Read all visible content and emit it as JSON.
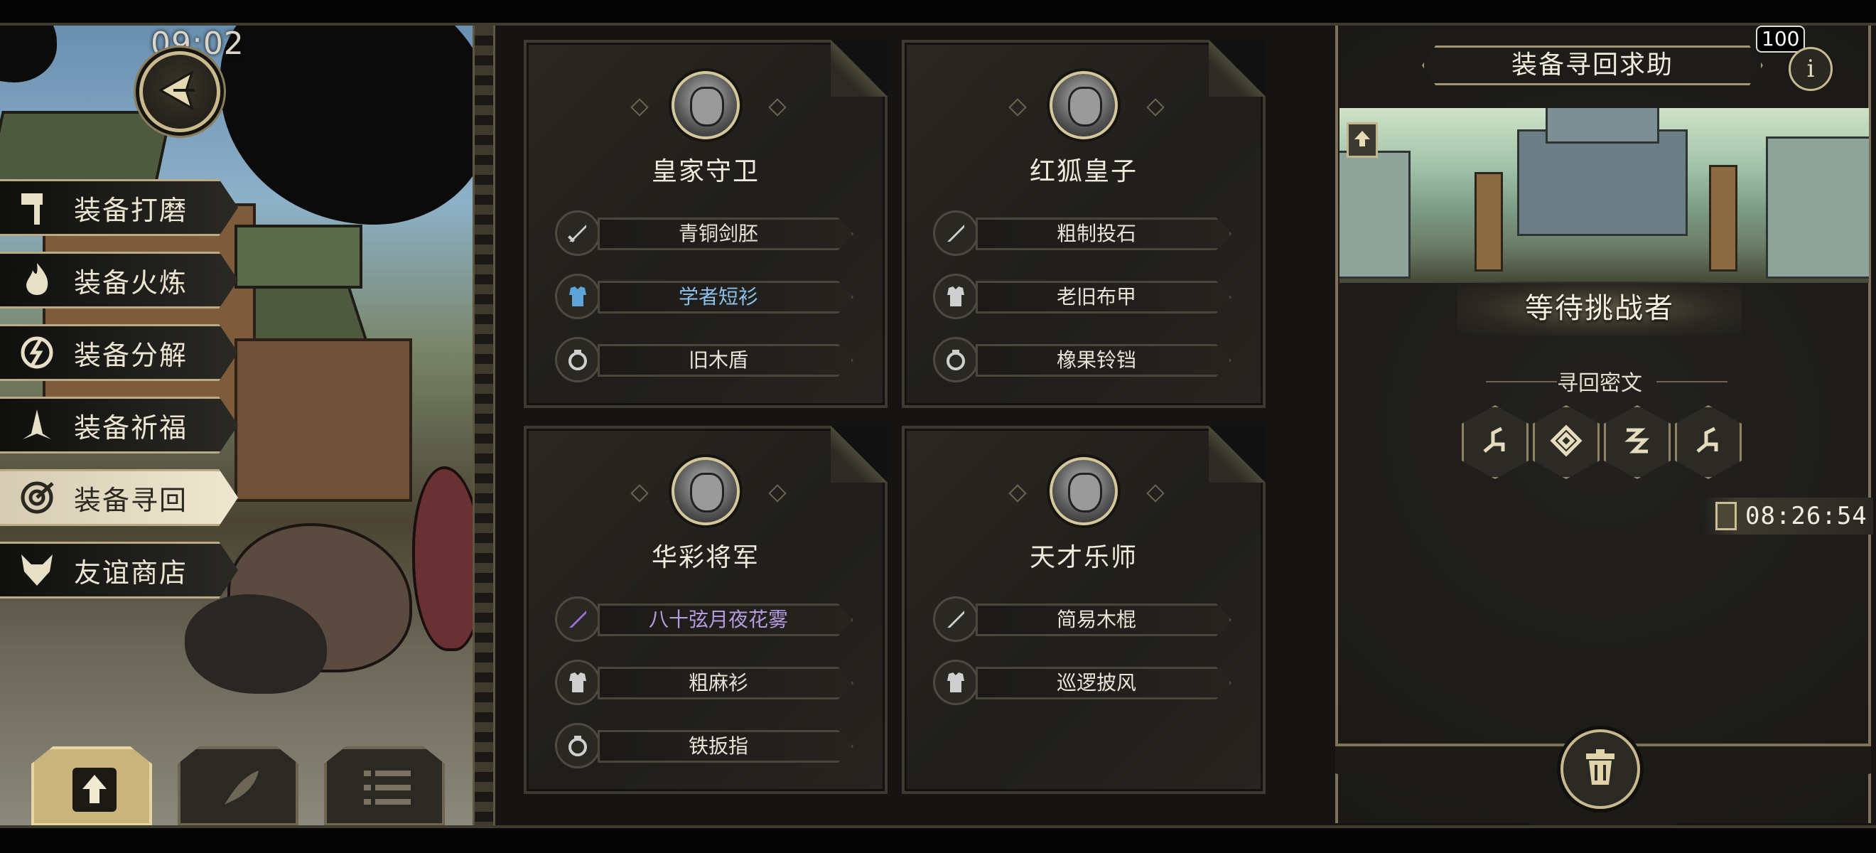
{
  "status": {
    "time": "09:02",
    "energy": "100"
  },
  "side_menu": {
    "items": [
      {
        "label": "装备打磨",
        "icon": "hammer-icon"
      },
      {
        "label": "装备火炼",
        "icon": "flame-icon"
      },
      {
        "label": "装备分解",
        "icon": "disassemble-icon"
      },
      {
        "label": "装备祈福",
        "icon": "prayer-icon"
      },
      {
        "label": "装备寻回",
        "icon": "target-icon",
        "active": true
      },
      {
        "label": "友谊商店",
        "icon": "fox-icon"
      }
    ]
  },
  "bottom_buttons": [
    {
      "icon": "upload-icon"
    },
    {
      "icon": "quill-icon"
    },
    {
      "icon": "list-icon"
    }
  ],
  "cards": [
    {
      "name": "皇家守卫",
      "portrait": "armored-knight-portrait",
      "items": [
        {
          "label": "青铜剑胚",
          "slot": "weapon",
          "rarity": "common"
        },
        {
          "label": "学者短衫",
          "slot": "armor",
          "rarity": "rare"
        },
        {
          "label": "旧木盾",
          "slot": "accessory",
          "rarity": "common"
        }
      ]
    },
    {
      "name": "红狐皇子",
      "portrait": "wolf-prince-portrait",
      "items": [
        {
          "label": "粗制投石",
          "slot": "weapon",
          "rarity": "common"
        },
        {
          "label": "老旧布甲",
          "slot": "armor",
          "rarity": "common"
        },
        {
          "label": "橡果铃铛",
          "slot": "accessory",
          "rarity": "common"
        }
      ]
    },
    {
      "name": "华彩将军",
      "portrait": "helmeted-general-portrait",
      "items": [
        {
          "label": "八十弦月夜花雾",
          "slot": "weapon",
          "rarity": "epic"
        },
        {
          "label": "粗麻衫",
          "slot": "armor",
          "rarity": "common"
        },
        {
          "label": "铁扳指",
          "slot": "accessory",
          "rarity": "common"
        }
      ]
    },
    {
      "name": "天才乐师",
      "portrait": "fox-musician-portrait",
      "items": [
        {
          "label": "简易木棍",
          "slot": "weapon",
          "rarity": "common"
        },
        {
          "label": "巡逻披风",
          "slot": "armor",
          "rarity": "common"
        }
      ]
    }
  ],
  "panel": {
    "title": "装备寻回求助",
    "info_glyph": "i",
    "status_text": "等待挑战者",
    "runes_title": "寻回密文",
    "runes": [
      "rune-1-icon",
      "rune-2-icon",
      "rune-3-icon",
      "rune-4-icon"
    ],
    "timer": "08:26:54"
  },
  "colors": {
    "gold": "#c9b98c",
    "rare": "#8cc0e8",
    "epic": "#b69ae0",
    "panel": "#1d1c18"
  }
}
